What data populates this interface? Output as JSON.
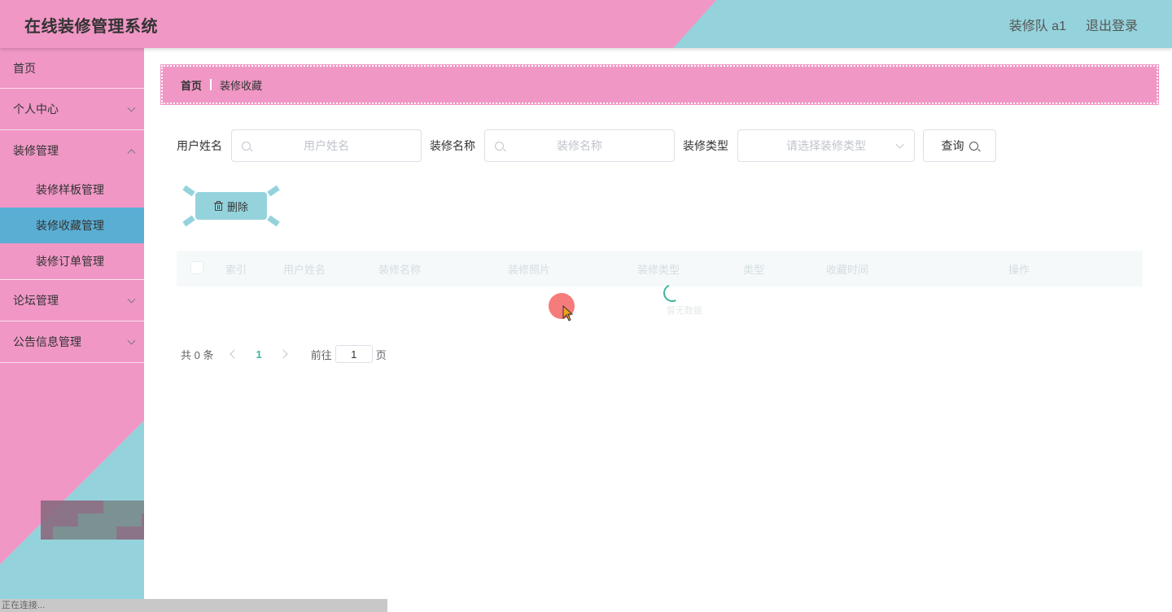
{
  "app": {
    "title": "在线装修管理系统",
    "user_label": "装修队 a1",
    "logout_label": "退出登录"
  },
  "sidebar": {
    "items": [
      {
        "label": "首页"
      },
      {
        "label": "个人中心"
      },
      {
        "label": "装修管理",
        "children": [
          {
            "label": "装修样板管理"
          },
          {
            "label": "装修收藏管理",
            "active": true
          },
          {
            "label": "装修订单管理"
          }
        ]
      },
      {
        "label": "论坛管理"
      },
      {
        "label": "公告信息管理"
      }
    ]
  },
  "status_bar": "正在连接...",
  "breadcrumb": {
    "home": "首页",
    "current": "装修收藏"
  },
  "search": {
    "username_label": "用户姓名",
    "username_placeholder": "用户姓名",
    "name_label": "装修名称",
    "name_placeholder": "装修名称",
    "type_label": "装修类型",
    "type_placeholder": "请选择装修类型",
    "query_label": "查询"
  },
  "toolbar": {
    "delete_label": "删除"
  },
  "table": {
    "columns": [
      "索引",
      "用户姓名",
      "装修名称",
      "装修照片",
      "装修类型",
      "类型",
      "收藏时间",
      "操作"
    ],
    "loading_text": "暂无数据"
  },
  "pagination": {
    "total_text": "共 0 条",
    "current_page": "1",
    "goto_label": "前往",
    "goto_value": "1",
    "page_suffix": "页"
  },
  "colors": {
    "pink": "#f097c5",
    "cyan": "#95d3dc",
    "active_blue": "#5aaed4",
    "accent_green": "#3cb79b"
  }
}
